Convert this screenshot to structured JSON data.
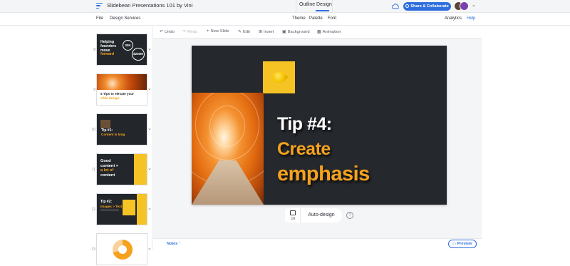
{
  "app": {
    "title": "Slidebean Presentations 101 by Vini"
  },
  "modes": {
    "outline": "Outline",
    "design": "Design"
  },
  "header": {
    "share_label": "Share & Collaborate"
  },
  "menubar": {
    "file": "File",
    "design_services": "Design Services",
    "theme": "Theme",
    "palette": "Palette",
    "font": "Font",
    "analytics": "Analytics",
    "help": "Help"
  },
  "toolbar": {
    "undo": "Undo",
    "redo": "Redo",
    "new_slide": "New Slide",
    "edit": "Edit",
    "insert": "Insert",
    "background": "Background",
    "animation": "Animation"
  },
  "thumbnails": [
    {
      "num": "8",
      "line1": "Helping",
      "line2": "founders",
      "line3": "move",
      "line4": "forward",
      "stat1": "30K",
      "stat2": "$250M"
    },
    {
      "num": "9",
      "line1": "5 Tips to elevate your",
      "line2": "slide design"
    },
    {
      "num": "10",
      "line1": "Tip #1:",
      "line2": "Content is king"
    },
    {
      "num": "11",
      "line1": "Good",
      "line2": "content =",
      "line3": "a lot of",
      "line4": "content"
    },
    {
      "num": "12",
      "line1": "Tip #2:",
      "line2": "Images > Text"
    },
    {
      "num": "13"
    }
  ],
  "slide": {
    "line1": "Tip #4:",
    "line2": "Create",
    "line3": "emphasis"
  },
  "auto_design": {
    "toggle_state": "Off",
    "label": "Auto-design",
    "help_glyph": "?"
  },
  "bottom": {
    "notes_label": "Notes",
    "preview_label": "Preview"
  },
  "colors": {
    "accent": "#2f6fde",
    "slide_bg": "#25282d",
    "highlight": "#f6a21e"
  }
}
